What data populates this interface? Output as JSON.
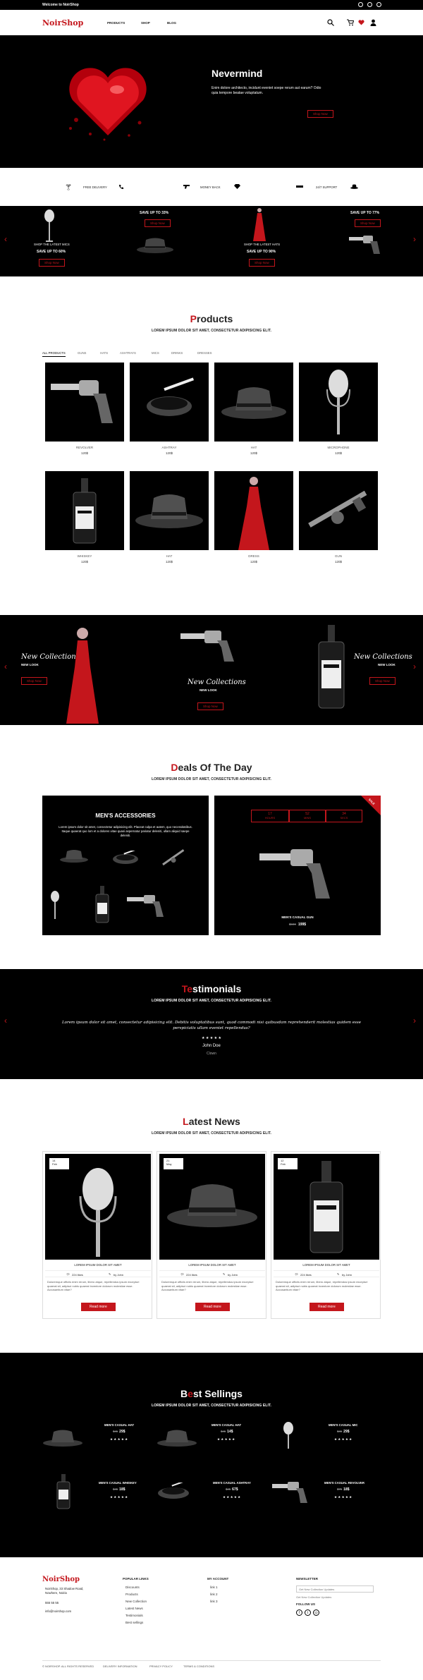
{
  "topbar": {
    "welcome": "Welcome to NoirShop"
  },
  "header": {
    "logo": "NoirShop",
    "nav": [
      "PRODUCTS",
      "SHOP",
      "BLOG"
    ]
  },
  "hero": {
    "title": "Nevermind",
    "text": "Enim dolore architecto, incidunt eveniet soepe rerum aut earum? Odio quia tempore beatae voluptatum.",
    "button": "Shop Now"
  },
  "features": [
    "FREE DELIVERY",
    "MONEY BACK",
    "24/7 SUPPORT"
  ],
  "promo": {
    "items": [
      {
        "top": "SAVE UP TO 33%",
        "button": "Shop Now"
      },
      {
        "top": "SHOP THE LATEST MICS",
        "sub": "SAVE UP TO 60%",
        "button": "Shop Now"
      },
      {
        "top": "SHOP THE LATEST HATS",
        "sub": "SAVE UP TO 90%",
        "button": "Shop Now"
      },
      {
        "top": "SAVE UP TO 77%",
        "button": "Shop Now"
      }
    ]
  },
  "products": {
    "title_first": "P",
    "title_rest": "roducts",
    "subtitle": "LOREM IPSUM DOLOR SIT AMET, CONSECTETUR ADIPISICING ELIT.",
    "tabs": [
      "ALL PRODUCTS",
      "GUNS",
      "HATS",
      "ASHTRAYS",
      "MICS",
      "DRINKS",
      "DRESSES"
    ],
    "items": [
      {
        "name": "REVOLVER",
        "price": "120$"
      },
      {
        "name": "ASHTRAY",
        "price": "120$"
      },
      {
        "name": "HAT",
        "price": "120$"
      },
      {
        "name": "MICROPHONE",
        "price": "120$"
      },
      {
        "name": "WHISKEY",
        "price": "120$"
      },
      {
        "name": "HAT",
        "price": "120$"
      },
      {
        "name": "DRESS",
        "price": "120$"
      },
      {
        "name": "GUN",
        "price": "120$"
      }
    ]
  },
  "collections": {
    "left": {
      "title": "New Collections",
      "sub": "NEW LOOK",
      "button": "Shop Now"
    },
    "center": {
      "title": "New Collections",
      "sub": "NEW LOOK",
      "button": "Shop Now"
    },
    "right": {
      "title": "New Collections",
      "sub": "NEW LOOK",
      "button": "Shop Now"
    }
  },
  "deals": {
    "title_first": "D",
    "title_rest": "eals Of The Day",
    "subtitle": "LOREM IPSUM DOLOR SIT AMET, CONSECTETUR ADIPISICING ELIT.",
    "left_title": "MEN'S ACCESSORIES",
    "left_text": "Lorem ipsum dolor sit amet, consectetur adipisicing elit. Placeat culpa et autem, quo necessitatibus. Itaque quaerat quo lom et a dolores vitae quasi aspernatur pariatur deleniti, ullam aliquid saepe deleniti.",
    "timer": [
      {
        "num": "17",
        "unit": "HOURS"
      },
      {
        "num": "52",
        "unit": "MINS"
      },
      {
        "num": "34",
        "unit": "SECS"
      }
    ],
    "badge": "SALE",
    "right_name": "MEN'S CASUAL GUN",
    "right_old": "$500",
    "right_price": "199$"
  },
  "testimonials": {
    "title_first": "Te",
    "title_rest": "stimonials",
    "subtitle": "LOREM IPSUM DOLOR SIT AMET, CONSECTETUR ADIPISICING ELIT.",
    "quote": "Lorem ipsum dolor sit amet, consectetur adipisicing elit. Debitis voluptatibus sunt, quod commodi nisi quibusdam reprehenderit molestias quidem esse perspiciatis ullam eveniet repellendus?",
    "stars": "★ ★ ★ ★ ★",
    "name": "John Doe",
    "role": "Clown"
  },
  "news": {
    "title_first": "L",
    "title_rest": "atest News",
    "subtitle": "LOREM IPSUM DOLOR SIT AMET, CONSECTETUR ADIPISICING ELIT.",
    "posts": [
      {
        "day": "14",
        "month": "Feb",
        "title": "LOREM IPSUM DOLOR SIT AMET",
        "comments": "224 likes",
        "author": "by John",
        "text": "Doloremque officiis enim rerum, libero atque, repellendus ipsum excepturi quaerat sit, adipisci nobis quaerat inventore dolorum molestiae esse. Accusantium vitae?",
        "button": "Read more"
      },
      {
        "day": "21",
        "month": "May",
        "title": "LOREM IPSUM DOLOR SIT AMET",
        "comments": "224 likes",
        "author": "by John",
        "text": "Doloremque officiis enim rerum, libero atque, repellendus ipsum excepturi quaerat sit, adipisci nobis quaerat inventore dolorum molestiae esse. Accusantium vitae?",
        "button": "Read more"
      },
      {
        "day": "12",
        "month": "Feb",
        "title": "LOREM IPSUM DOLOR SIT AMET",
        "comments": "224 likes",
        "author": "by John",
        "text": "Doloremque officiis enim rerum, libero atque, repellendus ipsum excepturi quaerat sit, adipisci nobis quaerat inventore dolorum molestiae esse. Accusantium vitae?",
        "button": "Read more"
      }
    ]
  },
  "bestsellings": {
    "title_first": "B",
    "title_mid": "e",
    "title_rest": "st Sellings",
    "subtitle": "LOREM IPSUM DOLOR SIT AMET, CONSECTETUR ADIPISICING ELIT.",
    "items": [
      {
        "name": "MEN'S CASUAL HAT",
        "old": "$45",
        "price": "29$"
      },
      {
        "name": "MEN'S CASUAL HAT",
        "old": "$45",
        "price": "14$"
      },
      {
        "name": "MEN'S CASUAL MIC",
        "old": "$45",
        "price": "29$"
      },
      {
        "name": "MEN'S CASUAL WHISKEY",
        "old": "$45",
        "price": "18$"
      },
      {
        "name": "MEN'S CASUAL ASHTRAY",
        "old": "$45",
        "price": "67$"
      },
      {
        "name": "MEN'S CASUAL REVOLVER",
        "old": "$75",
        "price": "18$"
      }
    ],
    "stars": "★ ★ ★ ★ ★"
  },
  "footer": {
    "logo": "NoirShop",
    "address": "NoirShop, 33 Shadow Road, Nowhere, Noiria",
    "phone": "555 55 55",
    "email": "info@noirshop.com",
    "col2_title": "POPULAR LINKS",
    "col2": [
      "Discounts",
      "Products",
      "New Collection",
      "Latest News",
      "Testimonials",
      "Best sellings"
    ],
    "col3_title": "MY ACCOUNT",
    "col3": [
      "link 1",
      "link 2",
      "link 3"
    ],
    "col4_title": "NEWSLETTER",
    "newsletter_placeholder": "Get New Collection Updates",
    "follow": "FOLLOW US",
    "copyright": "© NOIRSHOP. ALL RIGHTS RESERVED",
    "bottom_links": [
      "DELIVERY INFORMATION",
      "PRIVACY POLICY",
      "TERMS & CONDITIONS"
    ]
  },
  "colors": {
    "accent": "#c4161c",
    "dark": "#000000"
  }
}
